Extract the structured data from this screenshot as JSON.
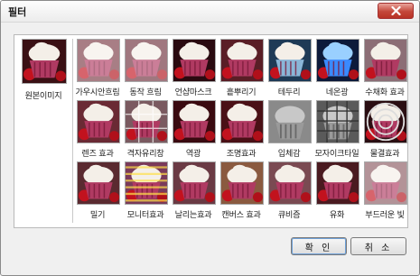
{
  "dialog": {
    "title": "필터"
  },
  "buttons": {
    "ok": "확 인",
    "cancel": "취 소"
  },
  "original": {
    "label": "원본이미지"
  },
  "filters": [
    {
      "label": "가우시안흐림",
      "effect": "blur"
    },
    {
      "label": "동작 흐림",
      "effect": "motion"
    },
    {
      "label": "언샵마스크",
      "effect": "sharp"
    },
    {
      "label": "흩뿌리기",
      "effect": "scatter"
    },
    {
      "label": "테두리",
      "effect": "edge"
    },
    {
      "label": "네온광",
      "effect": "neon"
    },
    {
      "label": "수채화 효과",
      "effect": "watercolor"
    },
    {
      "label": "렌즈 효과",
      "effect": "lens"
    },
    {
      "label": "격자유리창",
      "effect": "glass"
    },
    {
      "label": "역광",
      "effect": "backlight"
    },
    {
      "label": "조명효과",
      "effect": "light"
    },
    {
      "label": "입체감",
      "effect": "emboss"
    },
    {
      "label": "모자이크타일",
      "effect": "mosaic"
    },
    {
      "label": "물결효과",
      "effect": "ripple"
    },
    {
      "label": "밀기",
      "effect": "push"
    },
    {
      "label": "모니터효과",
      "effect": "monitor"
    },
    {
      "label": "날리는효과",
      "effect": "wind"
    },
    {
      "label": "캔버스 효과",
      "effect": "canvas"
    },
    {
      "label": "큐비즘",
      "effect": "cubism"
    },
    {
      "label": "유화",
      "effect": "oil"
    },
    {
      "label": "부드러운 빛",
      "effect": "soft"
    }
  ]
}
